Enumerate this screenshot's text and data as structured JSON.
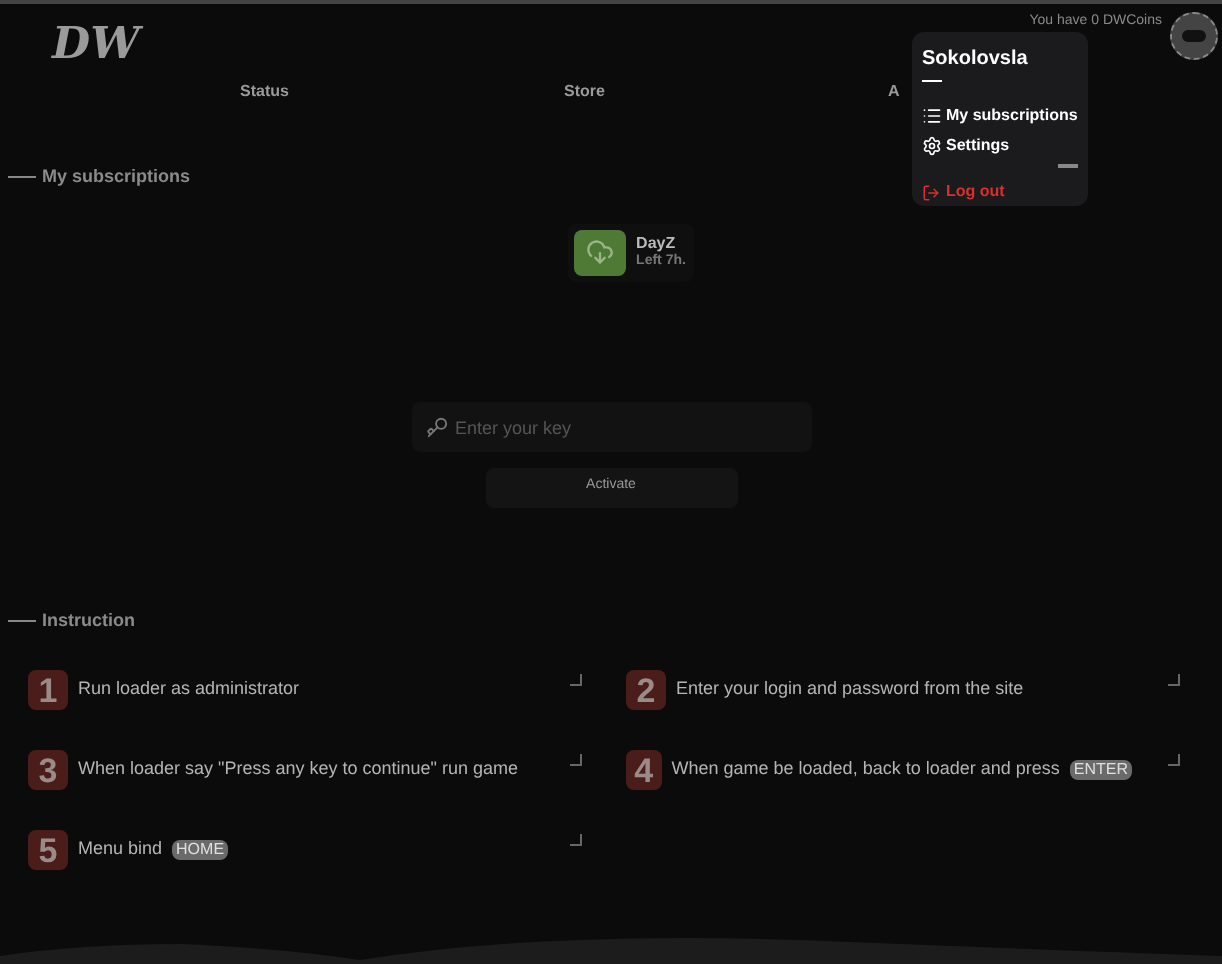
{
  "header": {
    "logo": "DW",
    "coins": "You have 0 DWCoins",
    "nav": [
      {
        "label": "Status"
      },
      {
        "label": "Store"
      },
      {
        "label": "A"
      }
    ]
  },
  "user_menu": {
    "username": "Sokolovsla",
    "items": [
      {
        "label": "My subscriptions",
        "kind": "list"
      },
      {
        "label": "Settings",
        "kind": "gears"
      }
    ],
    "logout": "Log out"
  },
  "subscriptions": {
    "title": "My subscriptions",
    "items": [
      {
        "name": "DayZ",
        "time_left": "Left 7h."
      }
    ]
  },
  "activation": {
    "placeholder": "Enter your key",
    "button": "Activate"
  },
  "instruction": {
    "title": "Instruction",
    "steps": [
      {
        "number": "1",
        "text": "Run loader as administrator"
      },
      {
        "number": "2",
        "text": "Enter your login and password from the site"
      },
      {
        "number": "3",
        "text": "When loader say \"Press any key to continue\" run game"
      },
      {
        "number": "4",
        "text": "When game be loaded, back to loader and press",
        "key": "ENTER"
      },
      {
        "number": "5",
        "text": "Menu bind",
        "key": "HOME"
      }
    ]
  }
}
